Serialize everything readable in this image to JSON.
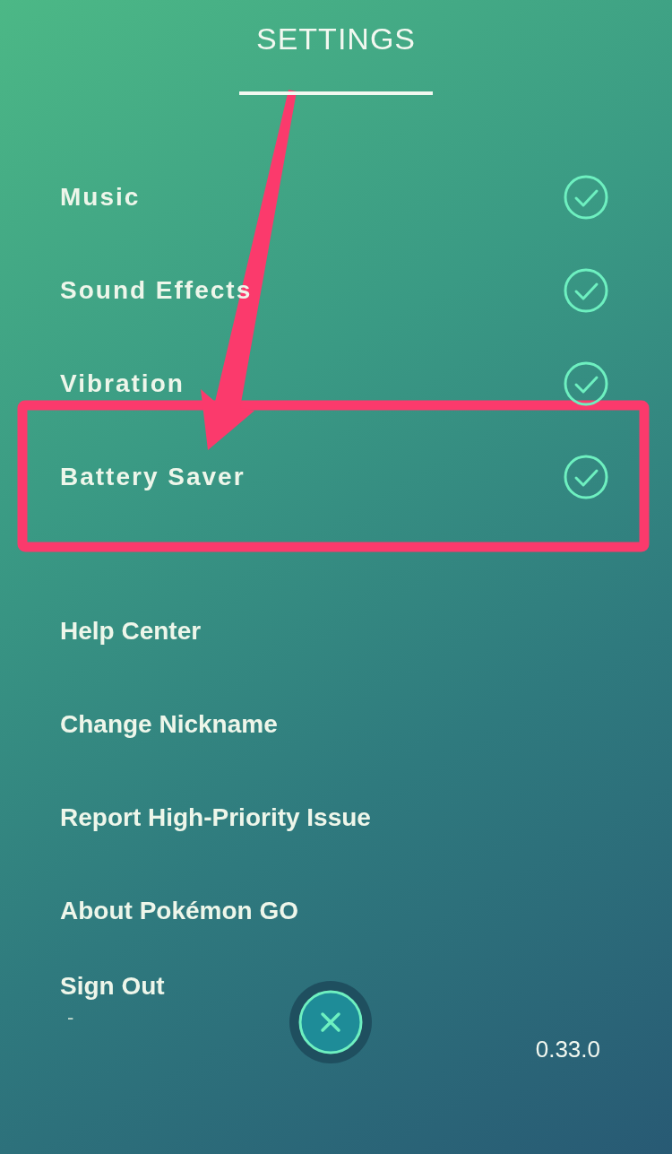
{
  "title": "SETTINGS",
  "toggles": [
    {
      "label": "Music",
      "checked": true
    },
    {
      "label": "Sound Effects",
      "checked": true
    },
    {
      "label": "Vibration",
      "checked": true
    },
    {
      "label": "Battery Saver",
      "checked": true
    }
  ],
  "links": [
    {
      "label": "Help Center"
    },
    {
      "label": "Change Nickname"
    },
    {
      "label": "Report High-Priority Issue"
    },
    {
      "label": "About Pokémon GO"
    }
  ],
  "sign_out": {
    "label": "Sign Out",
    "note": "-"
  },
  "version": "0.33.0"
}
